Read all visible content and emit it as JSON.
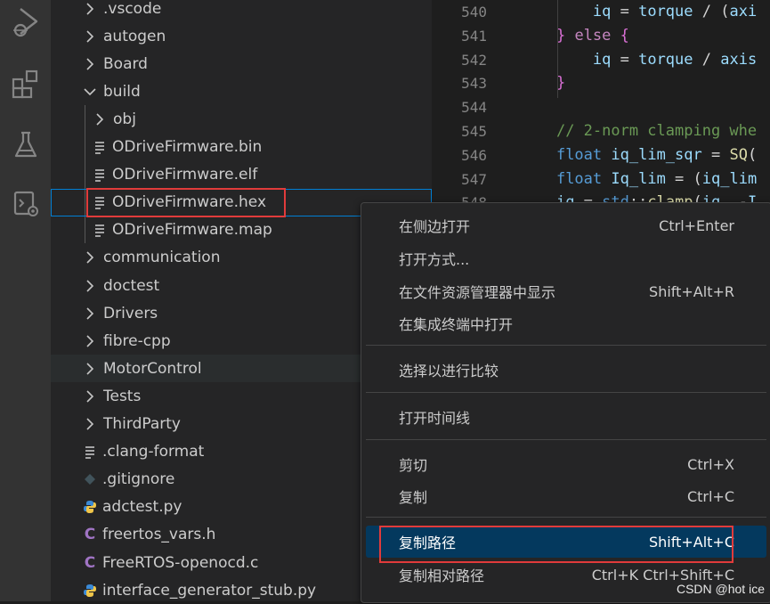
{
  "activity_bar": {
    "icons": [
      "run-debug-icon",
      "extensions-icon",
      "testing-icon",
      "remote-explorer-icon"
    ]
  },
  "explorer": {
    "items": [
      {
        "label": ".vscode",
        "kind": "folder",
        "expanded": false,
        "depth": 0
      },
      {
        "label": "autogen",
        "kind": "folder",
        "expanded": false,
        "depth": 0
      },
      {
        "label": "Board",
        "kind": "folder",
        "expanded": false,
        "depth": 0
      },
      {
        "label": "build",
        "kind": "folder",
        "expanded": true,
        "depth": 0
      },
      {
        "label": "obj",
        "kind": "folder",
        "expanded": false,
        "depth": 1
      },
      {
        "label": "ODriveFirmware.bin",
        "kind": "file",
        "depth": 1
      },
      {
        "label": "ODriveFirmware.elf",
        "kind": "file",
        "depth": 1
      },
      {
        "label": "ODriveFirmware.hex",
        "kind": "file",
        "depth": 1,
        "focused": true
      },
      {
        "label": "ODriveFirmware.map",
        "kind": "file",
        "depth": 1
      },
      {
        "label": "communication",
        "kind": "folder",
        "expanded": false,
        "depth": 0
      },
      {
        "label": "doctest",
        "kind": "folder",
        "expanded": false,
        "depth": 0
      },
      {
        "label": "Drivers",
        "kind": "folder",
        "expanded": false,
        "depth": 0
      },
      {
        "label": "fibre-cpp",
        "kind": "folder",
        "expanded": false,
        "depth": 0
      },
      {
        "label": "MotorControl",
        "kind": "folder",
        "expanded": false,
        "depth": 0,
        "hover": true
      },
      {
        "label": "Tests",
        "kind": "folder",
        "expanded": false,
        "depth": 0
      },
      {
        "label": "ThirdParty",
        "kind": "folder",
        "expanded": false,
        "depth": 0
      },
      {
        "label": ".clang-format",
        "kind": "file",
        "depth": 0
      },
      {
        "label": ".gitignore",
        "kind": "git",
        "depth": 0
      },
      {
        "label": "adctest.py",
        "kind": "python",
        "depth": 0
      },
      {
        "label": "freertos_vars.h",
        "kind": "c",
        "depth": 0
      },
      {
        "label": "FreeRTOS-openocd.c",
        "kind": "c",
        "depth": 0
      },
      {
        "label": "interface_generator_stub.py",
        "kind": "python",
        "depth": 0
      }
    ]
  },
  "editor": {
    "lines": [
      {
        "num": "540",
        "code": "        iq = torque / (axi"
      },
      {
        "num": "541",
        "code": "    } else {"
      },
      {
        "num": "542",
        "code": "        iq = torque / axis"
      },
      {
        "num": "543",
        "code": "    }"
      },
      {
        "num": "544",
        "code": ""
      },
      {
        "num": "545",
        "code": "    // 2-norm clamping whe"
      },
      {
        "num": "546",
        "code": "    float iq_lim_sqr = SQ("
      },
      {
        "num": "547",
        "code": "    float Iq_lim = (iq_lim"
      },
      {
        "num": "548",
        "code": "    iq = std::clamp(iq, -I"
      }
    ]
  },
  "context_menu": {
    "items": [
      {
        "label": "在侧边打开",
        "shortcut": "Ctrl+Enter"
      },
      {
        "label": "打开方式...",
        "shortcut": ""
      },
      {
        "label": "在文件资源管理器中显示",
        "shortcut": "Shift+Alt+R"
      },
      {
        "label": "在集成终端中打开",
        "shortcut": ""
      },
      {
        "label": "选择以进行比较",
        "shortcut": ""
      },
      {
        "label": "打开时间线",
        "shortcut": ""
      },
      {
        "label": "剪切",
        "shortcut": "Ctrl+X"
      },
      {
        "label": "复制",
        "shortcut": "Ctrl+C"
      },
      {
        "label": "复制路径",
        "shortcut": "Shift+Alt+C",
        "selected": true
      },
      {
        "label": "复制相对路径",
        "shortcut": "Ctrl+K Ctrl+Shift+C"
      }
    ]
  },
  "watermark": "CSDN @hot ice",
  "colors": {
    "selection": "#04395e",
    "highlight_box": "#e13b3b",
    "focus_outline": "#007fd4"
  }
}
